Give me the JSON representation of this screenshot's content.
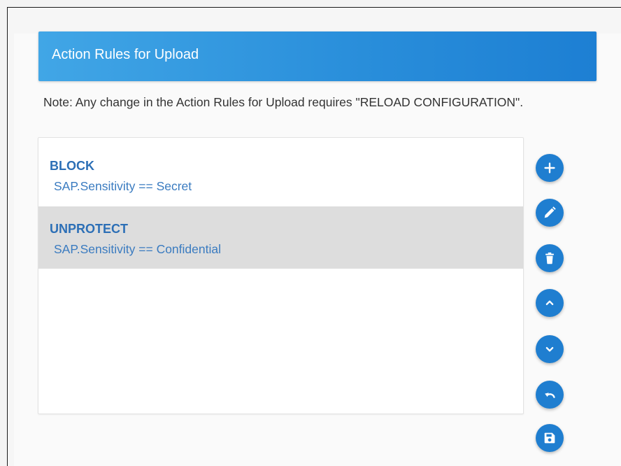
{
  "header": {
    "title": "Action Rules for Upload",
    "accent_color": "#2a8fdb"
  },
  "note": {
    "text": "Note: Any change in the Action Rules for Upload requires \"RELOAD CONFIGURATION\"."
  },
  "rules": [
    {
      "action": "BLOCK",
      "condition": "SAP.Sensitivity == Secret",
      "selected": false
    },
    {
      "action": "UNPROTECT",
      "condition": "SAP.Sensitivity == Confidential",
      "selected": true
    }
  ],
  "toolbar": {
    "buttons": [
      {
        "icon": "plus-icon",
        "action": "add"
      },
      {
        "icon": "pencil-icon",
        "action": "edit"
      },
      {
        "icon": "trash-icon",
        "action": "delete"
      },
      {
        "icon": "chevron-up-icon",
        "action": "move-up"
      },
      {
        "icon": "chevron-down-icon",
        "action": "move-down"
      },
      {
        "icon": "undo-icon",
        "action": "undo"
      },
      {
        "icon": "save-icon",
        "action": "save"
      }
    ],
    "button_color": "#1f7ed0"
  }
}
